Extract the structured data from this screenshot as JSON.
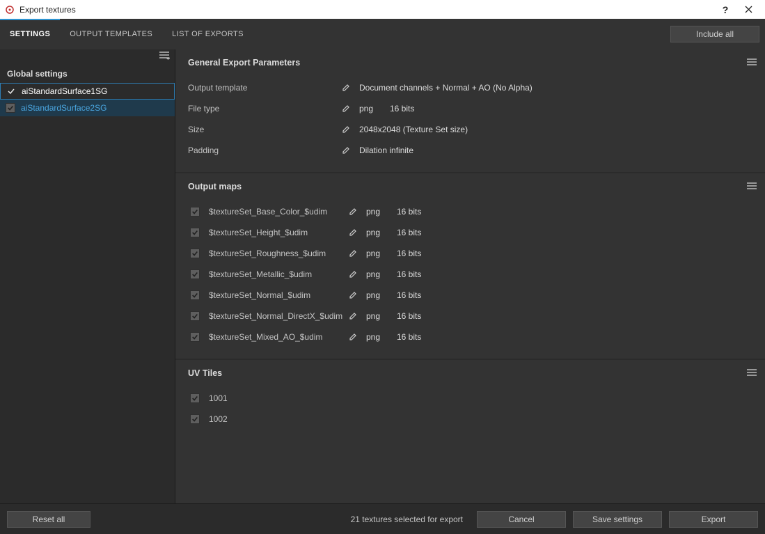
{
  "window": {
    "title": "Export textures"
  },
  "topbar": {
    "tabs": [
      {
        "label": "SETTINGS",
        "active": true
      },
      {
        "label": "OUTPUT TEMPLATES",
        "active": false
      },
      {
        "label": "LIST OF EXPORTS",
        "active": false
      }
    ],
    "include_all": "Include all"
  },
  "sidebar": {
    "heading": "Global settings",
    "items": [
      {
        "label": "aiStandardSurface1SG",
        "checked": true,
        "active": true,
        "highlight": false
      },
      {
        "label": "aiStandardSurface2SG",
        "checked": true,
        "active": false,
        "highlight": true
      }
    ]
  },
  "general": {
    "title": "General Export Parameters",
    "rows": [
      {
        "label": "Output template",
        "value": "Document channels + Normal + AO (No Alpha)"
      },
      {
        "label": "File type",
        "v1": "png",
        "v2": "16 bits"
      },
      {
        "label": "Size",
        "value": "2048x2048 (Texture Set size)"
      },
      {
        "label": "Padding",
        "value": "Dilation infinite"
      }
    ]
  },
  "maps": {
    "title": "Output maps",
    "rows": [
      {
        "checked": true,
        "name": "$textureSet_Base_Color_$udim",
        "fmt": "png",
        "bits": "16 bits"
      },
      {
        "checked": true,
        "name": "$textureSet_Height_$udim",
        "fmt": "png",
        "bits": "16 bits"
      },
      {
        "checked": true,
        "name": "$textureSet_Roughness_$udim",
        "fmt": "png",
        "bits": "16 bits"
      },
      {
        "checked": true,
        "name": "$textureSet_Metallic_$udim",
        "fmt": "png",
        "bits": "16 bits"
      },
      {
        "checked": true,
        "name": "$textureSet_Normal_$udim",
        "fmt": "png",
        "bits": "16 bits"
      },
      {
        "checked": true,
        "name": "$textureSet_Normal_DirectX_$udim",
        "fmt": "png",
        "bits": "16 bits"
      },
      {
        "checked": true,
        "name": "$textureSet_Mixed_AO_$udim",
        "fmt": "png",
        "bits": "16 bits"
      }
    ]
  },
  "uv": {
    "title": "UV Tiles",
    "tiles": [
      {
        "checked": true,
        "label": "1001"
      },
      {
        "checked": true,
        "label": "1002"
      }
    ]
  },
  "footer": {
    "reset": "Reset all",
    "status": "21 textures selected for export",
    "cancel": "Cancel",
    "save": "Save settings",
    "export": "Export"
  }
}
